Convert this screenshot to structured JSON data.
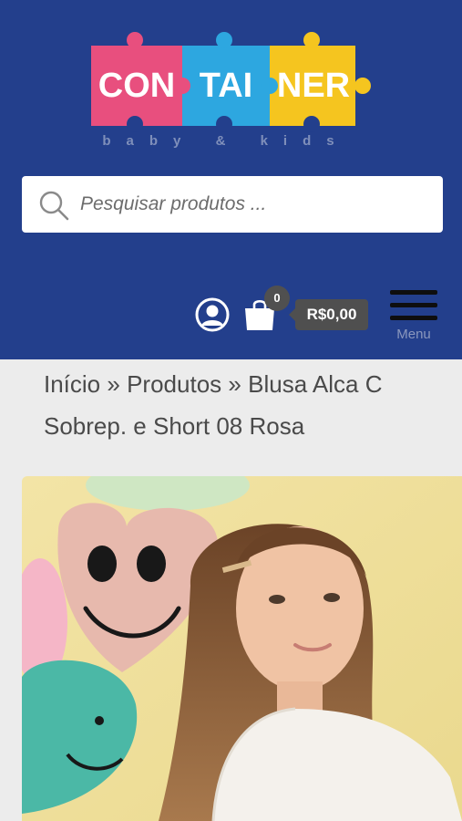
{
  "logo": {
    "pieces": [
      "CON",
      "TAI",
      "NER"
    ],
    "subtitle": "baby & kids",
    "colors": [
      "#e84f7e",
      "#2da7e0",
      "#f5c51f"
    ]
  },
  "search": {
    "placeholder": "Pesquisar produtos ...",
    "icon": "search-icon"
  },
  "header": {
    "background": "#233f8c",
    "account_icon": "user-icon",
    "cart": {
      "icon": "shopping-bag-icon",
      "count": "0",
      "total": "R$0,00"
    },
    "menu_label": "Menu"
  },
  "breadcrumb": {
    "home": "Início",
    "sep1": "»",
    "products": "Produtos",
    "sep2": "»",
    "current": "Blusa Alca C Sobrep. e Short 08 Rosa"
  },
  "product": {
    "image": "product-photo"
  }
}
